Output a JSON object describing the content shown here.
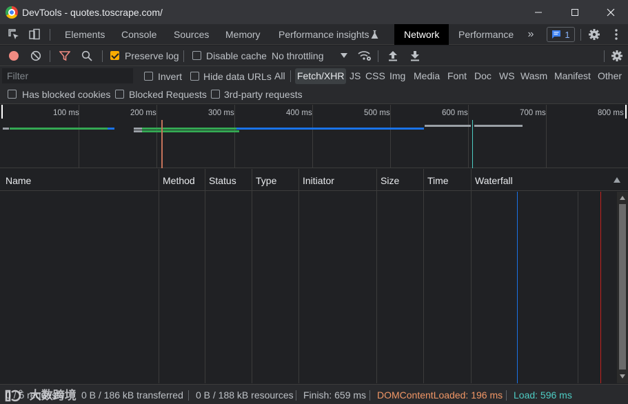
{
  "window": {
    "title": "DevTools - quotes.toscrape.com/",
    "minimize_icon": "minimize-icon",
    "maximize_icon": "maximize-icon",
    "close_icon": "close-icon"
  },
  "tabs": {
    "items": [
      {
        "label": "Elements"
      },
      {
        "label": "Console"
      },
      {
        "label": "Sources"
      },
      {
        "label": "Memory"
      },
      {
        "label": "Performance insights"
      },
      {
        "label": "Network"
      },
      {
        "label": "Performance"
      }
    ],
    "active": "Network",
    "issues_count": "1",
    "more_icon": "chevron-double-right-icon"
  },
  "toolbar": {
    "record_color": "#f28b82",
    "preserve_log_label": "Preserve log",
    "preserve_log_checked": true,
    "disable_cache_label": "Disable cache",
    "disable_cache_checked": false,
    "throttling_label": "No throttling"
  },
  "filter": {
    "placeholder": "Filter",
    "invert_label": "Invert",
    "hide_data_urls_label": "Hide data URLs",
    "types": [
      "All",
      "Fetch/XHR",
      "JS",
      "CSS",
      "Img",
      "Media",
      "Font",
      "Doc",
      "WS",
      "Wasm",
      "Manifest",
      "Other"
    ],
    "active_type": "Fetch/XHR",
    "has_blocked_cookies_label": "Has blocked cookies",
    "blocked_requests_label": "Blocked Requests",
    "third_party_label": "3rd-party requests"
  },
  "overview": {
    "ticks": [
      "100 ms",
      "200 ms",
      "300 ms",
      "400 ms",
      "500 ms",
      "600 ms",
      "700 ms",
      "800 ms"
    ]
  },
  "table": {
    "columns": [
      "Name",
      "Method",
      "Status",
      "Type",
      "Initiator",
      "Size",
      "Time",
      "Waterfall"
    ]
  },
  "status": {
    "requests": "0 / 5 requests",
    "transferred": "0 B / 186 kB transferred",
    "resources": "0 B / 188 kB resources",
    "finish": "Finish: 659 ms",
    "dom_content_loaded": "DOMContentLoaded: 196 ms",
    "load": "Load: 596 ms",
    "dcl_color": "#f29766",
    "load_color": "#4ecdc4"
  },
  "watermark": {
    "text": "大数跨境"
  }
}
